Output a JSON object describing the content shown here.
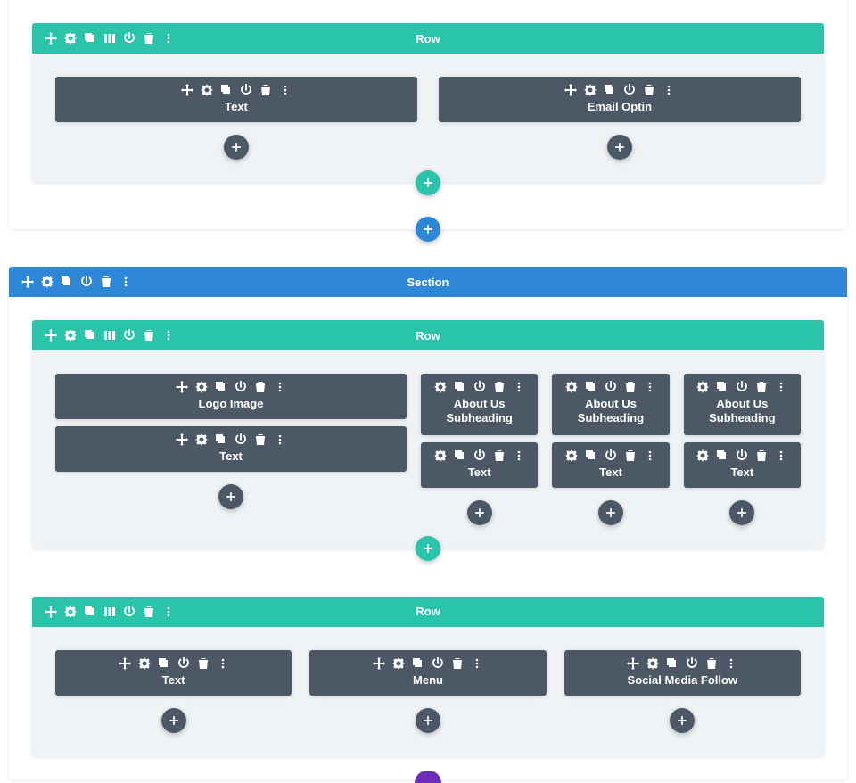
{
  "colors": {
    "row": "#29c4a9",
    "section": "#2e86d7",
    "module": "#4c5866",
    "purple": "#6c2eb9"
  },
  "section1": {
    "row1": {
      "title": "Row",
      "col1": {
        "m1": {
          "label": "Text"
        }
      },
      "col2": {
        "m1": {
          "label": "Email Optin"
        }
      }
    }
  },
  "section2": {
    "title": "Section",
    "row1": {
      "title": "Row",
      "col1": {
        "m1": {
          "label": "Logo Image"
        },
        "m2": {
          "label": "Text"
        }
      },
      "col2": {
        "m1": {
          "line1": "About Us",
          "line2": "Subheading"
        },
        "m2": {
          "label": "Text"
        }
      },
      "col3": {
        "m1": {
          "line1": "About Us",
          "line2": "Subheading"
        },
        "m2": {
          "label": "Text"
        }
      },
      "col4": {
        "m1": {
          "line1": "About Us",
          "line2": "Subheading"
        },
        "m2": {
          "label": "Text"
        }
      }
    },
    "row2": {
      "title": "Row",
      "col1": {
        "m1": {
          "label": "Text"
        }
      },
      "col2": {
        "m1": {
          "label": "Menu"
        }
      },
      "col3": {
        "m1": {
          "label": "Social Media Follow"
        }
      }
    }
  },
  "icons": {
    "move": "move-icon",
    "gear": "gear-icon",
    "duplicate": "duplicate-icon",
    "columns": "columns-icon",
    "power": "power-icon",
    "trash": "trash-icon",
    "menu": "menu-icon",
    "chevron": "chevron-up-icon",
    "plus": "plus-icon"
  }
}
